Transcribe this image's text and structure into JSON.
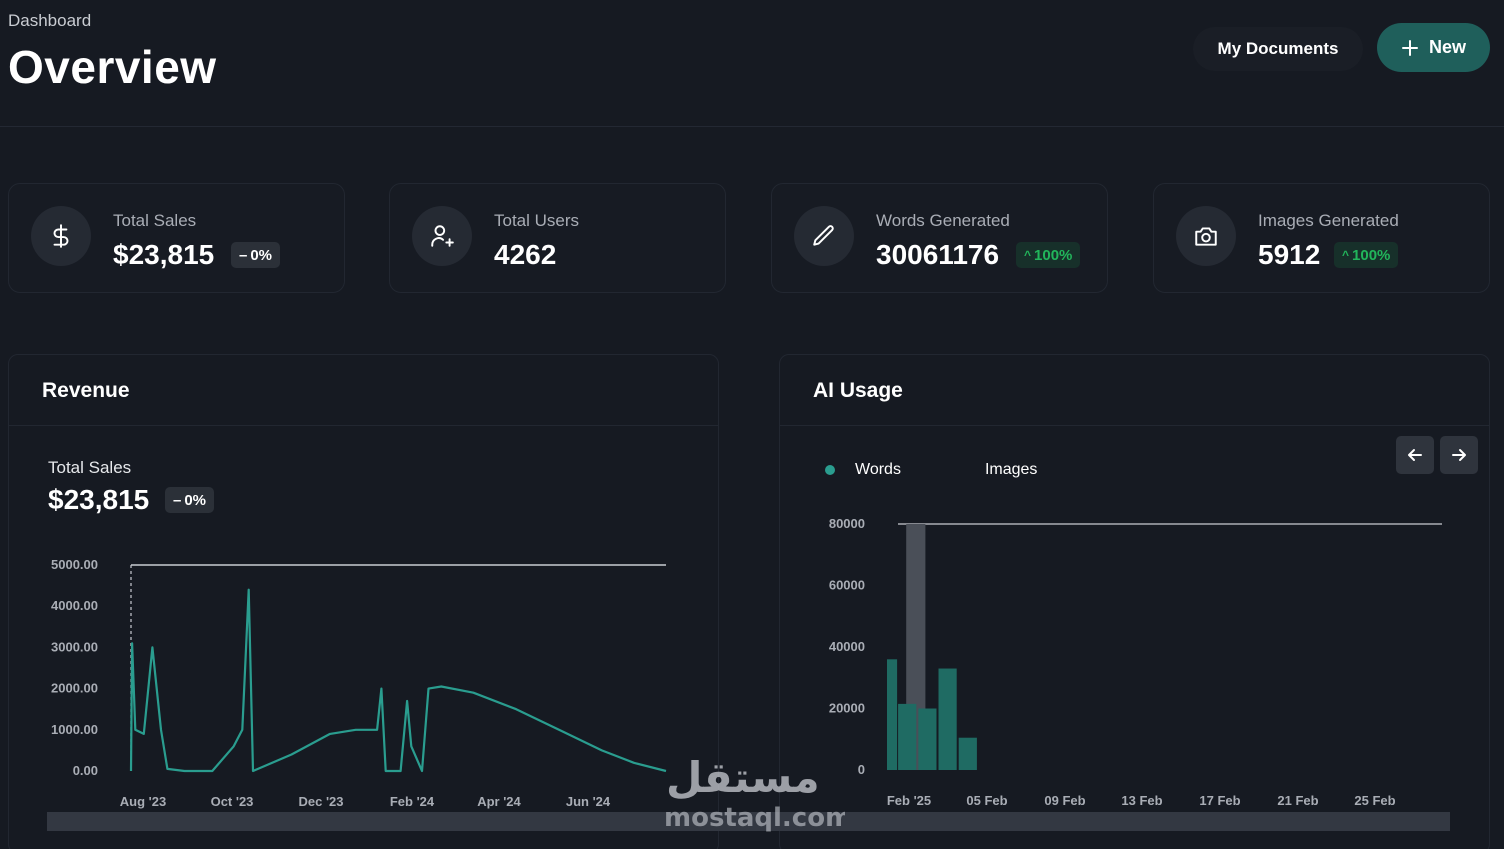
{
  "header": {
    "breadcrumb": "Dashboard",
    "title": "Overview",
    "my_documents_label": "My Documents",
    "new_label": "New"
  },
  "stats": [
    {
      "label": "Total Sales",
      "value": "$23,815",
      "badge": "0%",
      "trend": "neutral",
      "icon": "dollar-icon"
    },
    {
      "label": "Total Users",
      "value": "4262",
      "badge": "",
      "trend": "none",
      "icon": "user-plus-icon"
    },
    {
      "label": "Words Generated",
      "value": "30061176",
      "badge": "100%",
      "trend": "up",
      "icon": "pencil-icon"
    },
    {
      "label": "Images Generated",
      "value": "5912",
      "badge": "100%",
      "trend": "up",
      "icon": "camera-icon"
    }
  ],
  "revenue": {
    "title": "Revenue",
    "summary_label": "Total Sales",
    "summary_value": "$23,815",
    "summary_badge": "0%"
  },
  "ai_usage": {
    "title": "AI Usage",
    "legend": [
      "Words",
      "Images"
    ]
  },
  "watermark": {
    "text": "mostaql.com"
  },
  "colors": {
    "accent": "#1f5f5b",
    "series": "#2a9d8f",
    "bar": "#1f6b63",
    "positive": "#22b55b",
    "background": "#161a22"
  },
  "chart_data": [
    {
      "type": "line",
      "title": "Total Sales",
      "x_ticks": [
        "Aug '23",
        "Oct '23",
        "Dec '23",
        "Feb '24",
        "Apr '24",
        "Jun '24"
      ],
      "y_ticks": [
        "0.00",
        "1000.00",
        "2000.00",
        "3000.00",
        "4000.00",
        "5000.00"
      ],
      "ylim": [
        0,
        5000
      ],
      "series": [
        {
          "values": [
            [
              0,
              0
            ],
            [
              0.05,
              3100
            ],
            [
              0.2,
              1000
            ],
            [
              0.6,
              900
            ],
            [
              1.0,
              3000
            ],
            [
              1.4,
              1000
            ],
            [
              1.7,
              50
            ],
            [
              2.5,
              0
            ],
            [
              3.8,
              0
            ],
            [
              4.8,
              600
            ],
            [
              5.2,
              1000
            ],
            [
              5.5,
              4400
            ],
            [
              5.7,
              0
            ],
            [
              7.5,
              400
            ],
            [
              9.3,
              900
            ],
            [
              10.5,
              1000
            ],
            [
              11.5,
              1000
            ],
            [
              11.7,
              2000
            ],
            [
              11.9,
              0
            ],
            [
              12.6,
              0
            ],
            [
              12.9,
              1700
            ],
            [
              13.1,
              600
            ],
            [
              13.6,
              0
            ],
            [
              13.9,
              2000
            ],
            [
              14.5,
              2050
            ],
            [
              16.0,
              1900
            ],
            [
              18.0,
              1500
            ],
            [
              20.0,
              1000
            ],
            [
              22.0,
              500
            ],
            [
              23.5,
              200
            ],
            [
              25.0,
              0
            ]
          ]
        }
      ],
      "grid": false
    },
    {
      "type": "bar",
      "title": "AI Usage",
      "x_ticks": [
        "Feb '25",
        "05 Feb",
        "09 Feb",
        "13 Feb",
        "17 Feb",
        "21 Feb",
        "25 Feb"
      ],
      "y_ticks": [
        "0",
        "20000",
        "40000",
        "60000",
        "80000"
      ],
      "ylim": [
        0,
        80000
      ],
      "series": [
        {
          "name": "Words",
          "values": [
            36000,
            21500,
            20000,
            33000,
            10500,
            0,
            0,
            0,
            0,
            0,
            0,
            0,
            0,
            0,
            0,
            0,
            0,
            0,
            0,
            0,
            0,
            0,
            0,
            0,
            0,
            0,
            0,
            0
          ]
        }
      ],
      "highlight": {
        "index": 1,
        "value": 80000
      },
      "legend_position": "top-left",
      "grid": false
    }
  ]
}
